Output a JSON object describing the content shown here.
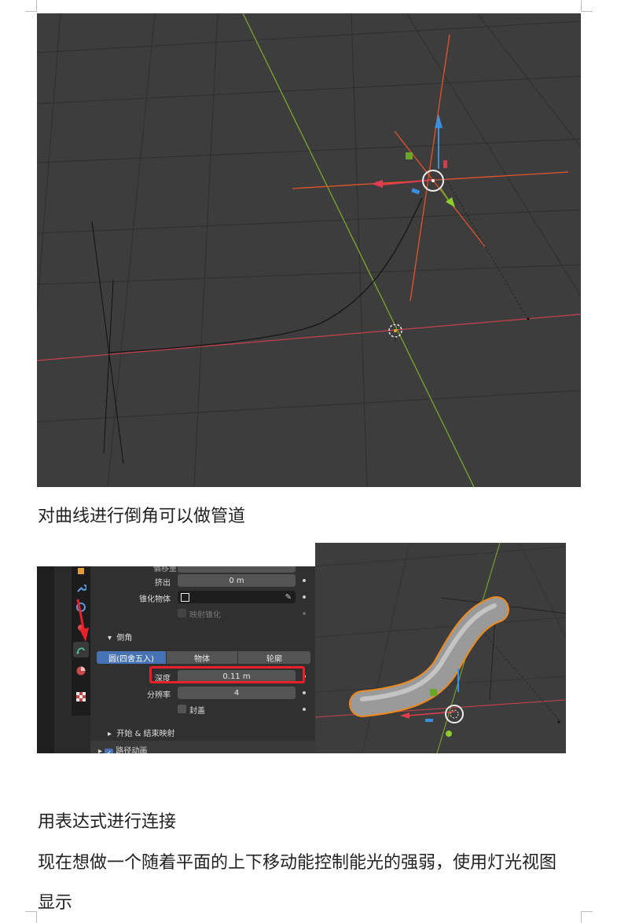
{
  "viewport_top": {
    "name": "3D viewport - curve with transform gizmo",
    "colors": {
      "background": "#3d3d3d",
      "x_axis": "#c8414f",
      "y_axis": "#7ba62c",
      "gizmo_red": "#e3542a",
      "gizmo_blue": "#3b8fe0"
    }
  },
  "paragraphs": {
    "p1": "对曲线进行倒角可以做管道",
    "p2": "用表达式进行连接",
    "p3": "现在想做一个随着平面的上下移动能控制能光的强弱，使用灯光视图",
    "p4": "显示"
  },
  "panel": {
    "clipped_top_label": "偏移量",
    "extrude_label": "挤出",
    "extrude_value": "0 m",
    "taper_label": "锥化物体",
    "map_taper_label": "映射锥化",
    "bevel_section": "倒角",
    "bevel_modes": [
      "圆(四舍五入)",
      "物体",
      "轮廓"
    ],
    "active_mode": "圆(四舍五入)",
    "depth_label": "深度",
    "depth_value": "0.11 m",
    "resolution_label": "分辨率",
    "resolution_value": "4",
    "fill_caps_label": "封盖",
    "start_end_mapping": "开始 & 结束映射",
    "path_animation": "路径动画",
    "icons": [
      "object-icon",
      "wrench-icon",
      "particles-icon",
      "physics-icon",
      "curve-data-icon",
      "material-icon",
      "texture-icon"
    ],
    "highlight_color": "#e8202a"
  },
  "viewport_bottom": {
    "name": "3D viewport - beveled tube",
    "colors": {
      "tube": "#9a9a9a",
      "outline": "#f08a1c"
    }
  }
}
